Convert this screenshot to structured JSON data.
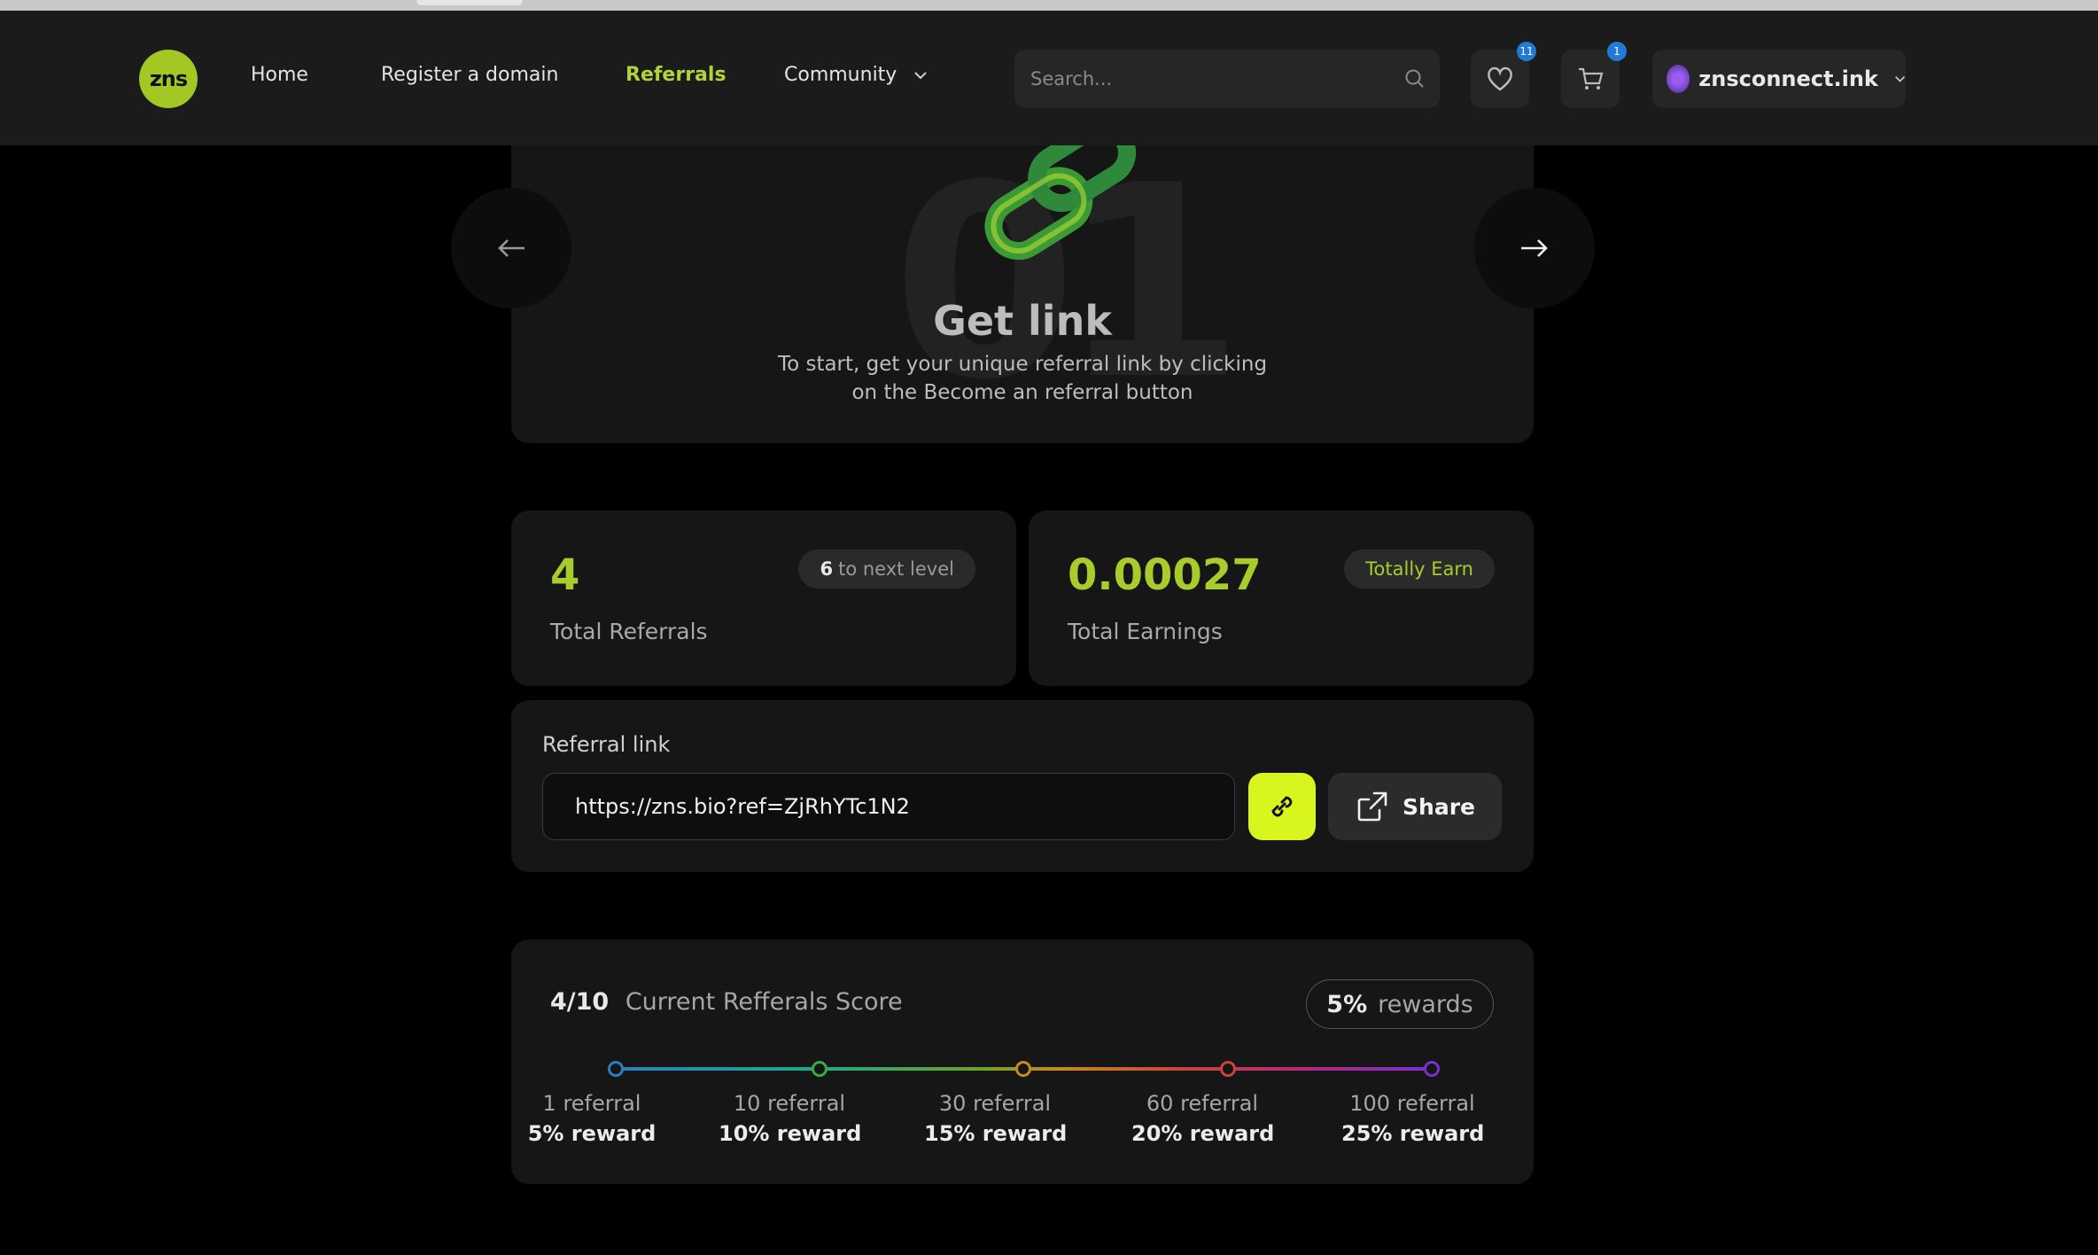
{
  "nav": {
    "logo_text": "zns",
    "links": [
      "Home",
      "Register a domain",
      "Referrals",
      "Community"
    ],
    "search_placeholder": "Search...",
    "favorites_count": "11",
    "cart_count": "1",
    "account_name": "znsconnect.ink"
  },
  "hero": {
    "step_number": "01",
    "title": "Get link",
    "description_line1": "To start, get your unique referral link by clicking",
    "description_line2": "on the Become an referral button"
  },
  "stats": {
    "referrals_value": "4",
    "referrals_label": "Total Referrals",
    "next_level_count": "6",
    "next_level_text": "to next level",
    "earnings_value": "0.00027",
    "earnings_label": "Total Earnings",
    "earnings_pill": "Totally Earn"
  },
  "referral": {
    "title": "Referral link",
    "link": "https://zns.bio?ref=ZjRhYTc1N2",
    "share_label": "Share"
  },
  "score": {
    "current": "4/10",
    "label": "Current Refferals Score",
    "reward_percent": "5%",
    "reward_label": "rewards",
    "tiers": [
      {
        "referrals": "1 referral",
        "reward": "5% reward",
        "color": "#2c7ec0"
      },
      {
        "referrals": "10 referral",
        "reward": "10% reward",
        "color": "#3aa848"
      },
      {
        "referrals": "30 referral",
        "reward": "15% reward",
        "color": "#c88a1c"
      },
      {
        "referrals": "60 referral",
        "reward": "20% reward",
        "color": "#c9433a"
      },
      {
        "referrals": "100 referral",
        "reward": "25% reward",
        "color": "#7b2fd0"
      }
    ]
  },
  "colors": {
    "accent": "#a7cc2b",
    "copy_button": "#d8f51d",
    "badge": "#1f7bd6"
  }
}
